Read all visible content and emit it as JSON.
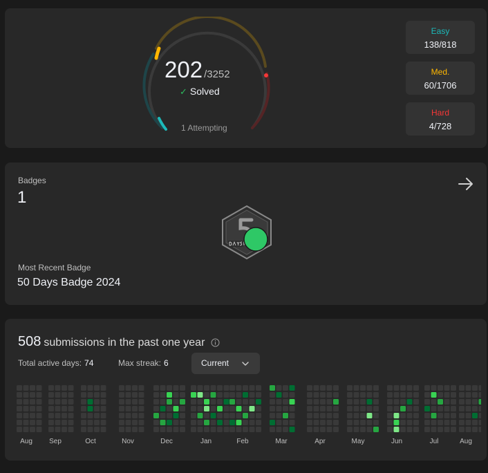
{
  "progress": {
    "solved": "202",
    "total": "/3252",
    "solved_label": "Solved",
    "attempting": "1 Attempting",
    "difficulties": [
      {
        "name": "Easy",
        "value": "138/818",
        "color": "#1cbaba"
      },
      {
        "name": "Med.",
        "value": "60/1706",
        "color": "#ffb700"
      },
      {
        "name": "Hard",
        "value": "4/728",
        "color": "#f63737"
      }
    ]
  },
  "badges": {
    "label": "Badges",
    "count": "1",
    "recent_label": "Most Recent Badge",
    "recent_name": "50 Days Badge 2024",
    "badge_icon": "50-days-badge-icon"
  },
  "activity": {
    "submissions": "508",
    "submissions_text": "submissions in the past one year",
    "active_days_label": "Total active days:",
    "active_days": "74",
    "max_streak_label": "Max streak:",
    "max_streak": "6",
    "range_select": "Current",
    "months": [
      "Aug",
      "Sep",
      "Oct",
      "Nov",
      "Dec",
      "Jan",
      "Feb",
      "Mar",
      "Apr",
      "May",
      "Jun",
      "Jul",
      "Aug"
    ]
  },
  "colors": {
    "empty_cell": "#393939",
    "level1": "#0e4429",
    "level2": "#006d32",
    "level3": "#26a641",
    "level4": "#39d353",
    "level5": "#7ee787"
  }
}
